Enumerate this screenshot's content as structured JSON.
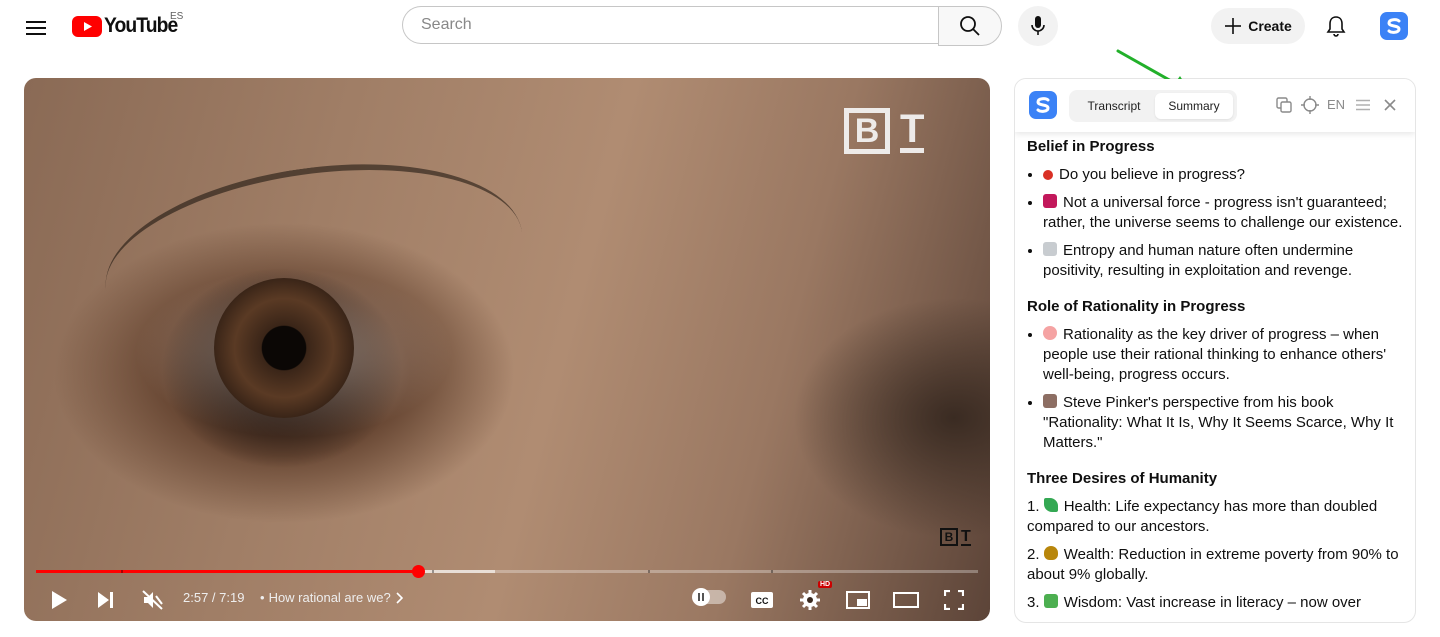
{
  "header": {
    "logo_text": "YouTube",
    "country_code": "ES",
    "search_placeholder": "Search",
    "create_label": "Create"
  },
  "player": {
    "time_current": "2:57",
    "time_total": "7:19",
    "time_display": "2:57 / 7:19",
    "chapter_bullet": "•",
    "chapter_title": "How rational are we?",
    "watermark_b": "B",
    "watermark_t": "T",
    "hd_badge": "HD",
    "progress_played_fraction": 0.406,
    "progress_buffered_fraction": 0.487,
    "chapter_marks": [
      0.09,
      0.42,
      0.65,
      0.78
    ]
  },
  "panel": {
    "tabs": [
      {
        "label": "Transcript",
        "active": false
      },
      {
        "label": "Summary",
        "active": true
      }
    ],
    "language": "EN",
    "sections": [
      {
        "heading": "Belief in Progress",
        "type": "bullets",
        "items": [
          {
            "emoji_name": "question-mark-emoji",
            "emoji_color": "#d93025",
            "text": "Do you believe in progress?"
          },
          {
            "emoji_name": "broken-heart-emoji",
            "emoji_color": "#c2185b",
            "text": "Not a universal force - progress isn't guaranteed; rather, the universe seems to challenge our existence."
          },
          {
            "emoji_name": "chart-decreasing-emoji",
            "emoji_color": "#9aa0a6",
            "text": "Entropy and human nature often undermine positivity, resulting in exploitation and revenge."
          }
        ]
      },
      {
        "heading": "Role of Rationality in Progress",
        "type": "bullets",
        "items": [
          {
            "emoji_name": "brain-emoji",
            "emoji_color": "#f28b82",
            "text": "Rationality as the key driver of progress – when people use their rational thinking to enhance others' well-being, progress occurs."
          },
          {
            "emoji_name": "books-emoji",
            "emoji_color": "#8d6e63",
            "text": "Steve Pinker's perspective from his book \"Rationality: What It Is, Why It Seems Scarce, Why It Matters.\""
          }
        ]
      },
      {
        "heading": "Three Desires of Humanity",
        "type": "numbered",
        "items": [
          {
            "number": "1.",
            "emoji_name": "seedling-emoji",
            "emoji_color": "#34a853",
            "text": "Health: Life expectancy has more than doubled compared to our ancestors."
          },
          {
            "number": "2.",
            "emoji_name": "money-bag-emoji",
            "emoji_color": "#b8860b",
            "text": "Wealth: Reduction in extreme poverty from 90% to about 9% globally."
          },
          {
            "number": "3.",
            "emoji_name": "books-emoji",
            "emoji_color": "#4caf50",
            "text": "Wisdom: Vast increase in literacy – now over"
          }
        ]
      }
    ]
  },
  "colors": {
    "youtube_red": "#ff0000",
    "extension_blue": "#3b82f6",
    "annotation_arrow": "#22b02a"
  }
}
